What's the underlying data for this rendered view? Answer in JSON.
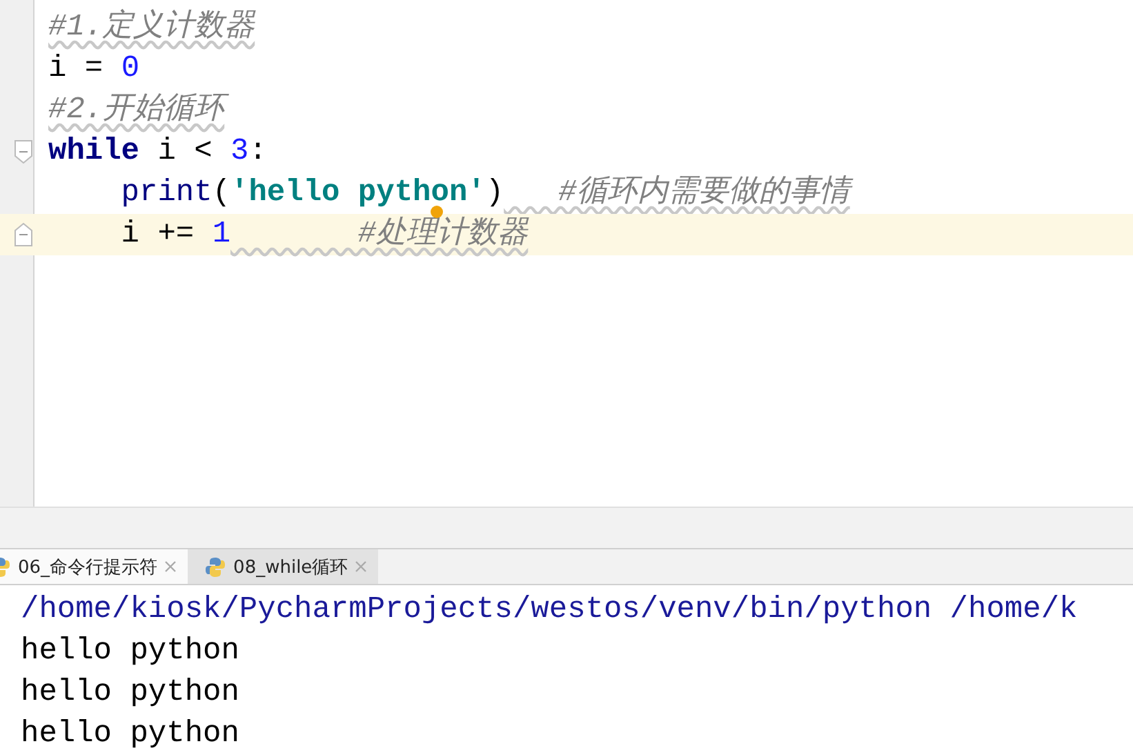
{
  "editor": {
    "lines": [
      {
        "current": false,
        "fold": false,
        "tokens": [
          {
            "kind": "comment",
            "text": "#1.定义计数器"
          }
        ]
      },
      {
        "current": false,
        "fold": false,
        "tokens": [
          {
            "kind": "plain",
            "text": "i = "
          },
          {
            "kind": "number",
            "text": "0"
          }
        ]
      },
      {
        "current": false,
        "fold": false,
        "tokens": [
          {
            "kind": "comment",
            "text": "#2.开始循环"
          }
        ]
      },
      {
        "current": false,
        "fold": true,
        "tokens": [
          {
            "kind": "keyword",
            "text": "while"
          },
          {
            "kind": "plain",
            "text": " i < "
          },
          {
            "kind": "number",
            "text": "3"
          },
          {
            "kind": "plain",
            "text": ":"
          }
        ],
        "children": [
          {
            "current": false,
            "fold": false,
            "tokens": [
              {
                "kind": "builtin",
                "text": "print"
              },
              {
                "kind": "plain",
                "text": "("
              },
              {
                "kind": "string",
                "text": "'hello python'"
              },
              {
                "kind": "plain",
                "text": ")"
              },
              {
                "kind": "comment",
                "text": "   #循环内需要做的事情"
              }
            ]
          },
          {
            "current": true,
            "fold": true,
            "caret_marker": true,
            "tokens": [
              {
                "kind": "plain",
                "text": "i += "
              },
              {
                "kind": "number",
                "text": "1"
              },
              {
                "kind": "comment",
                "text": "       #处理计数器"
              }
            ]
          }
        ]
      }
    ]
  },
  "run_tabs": [
    {
      "label": "06_命令行提示符",
      "selected": false
    },
    {
      "label": "08_while循环",
      "selected": true
    }
  ],
  "console": {
    "lines": [
      {
        "kind": "command",
        "text": "/home/kiosk/PycharmProjects/westos/venv/bin/python /home/k"
      },
      {
        "kind": "output",
        "text": "hello python"
      },
      {
        "kind": "output",
        "text": "hello python"
      },
      {
        "kind": "output",
        "text": "hello python"
      }
    ]
  }
}
